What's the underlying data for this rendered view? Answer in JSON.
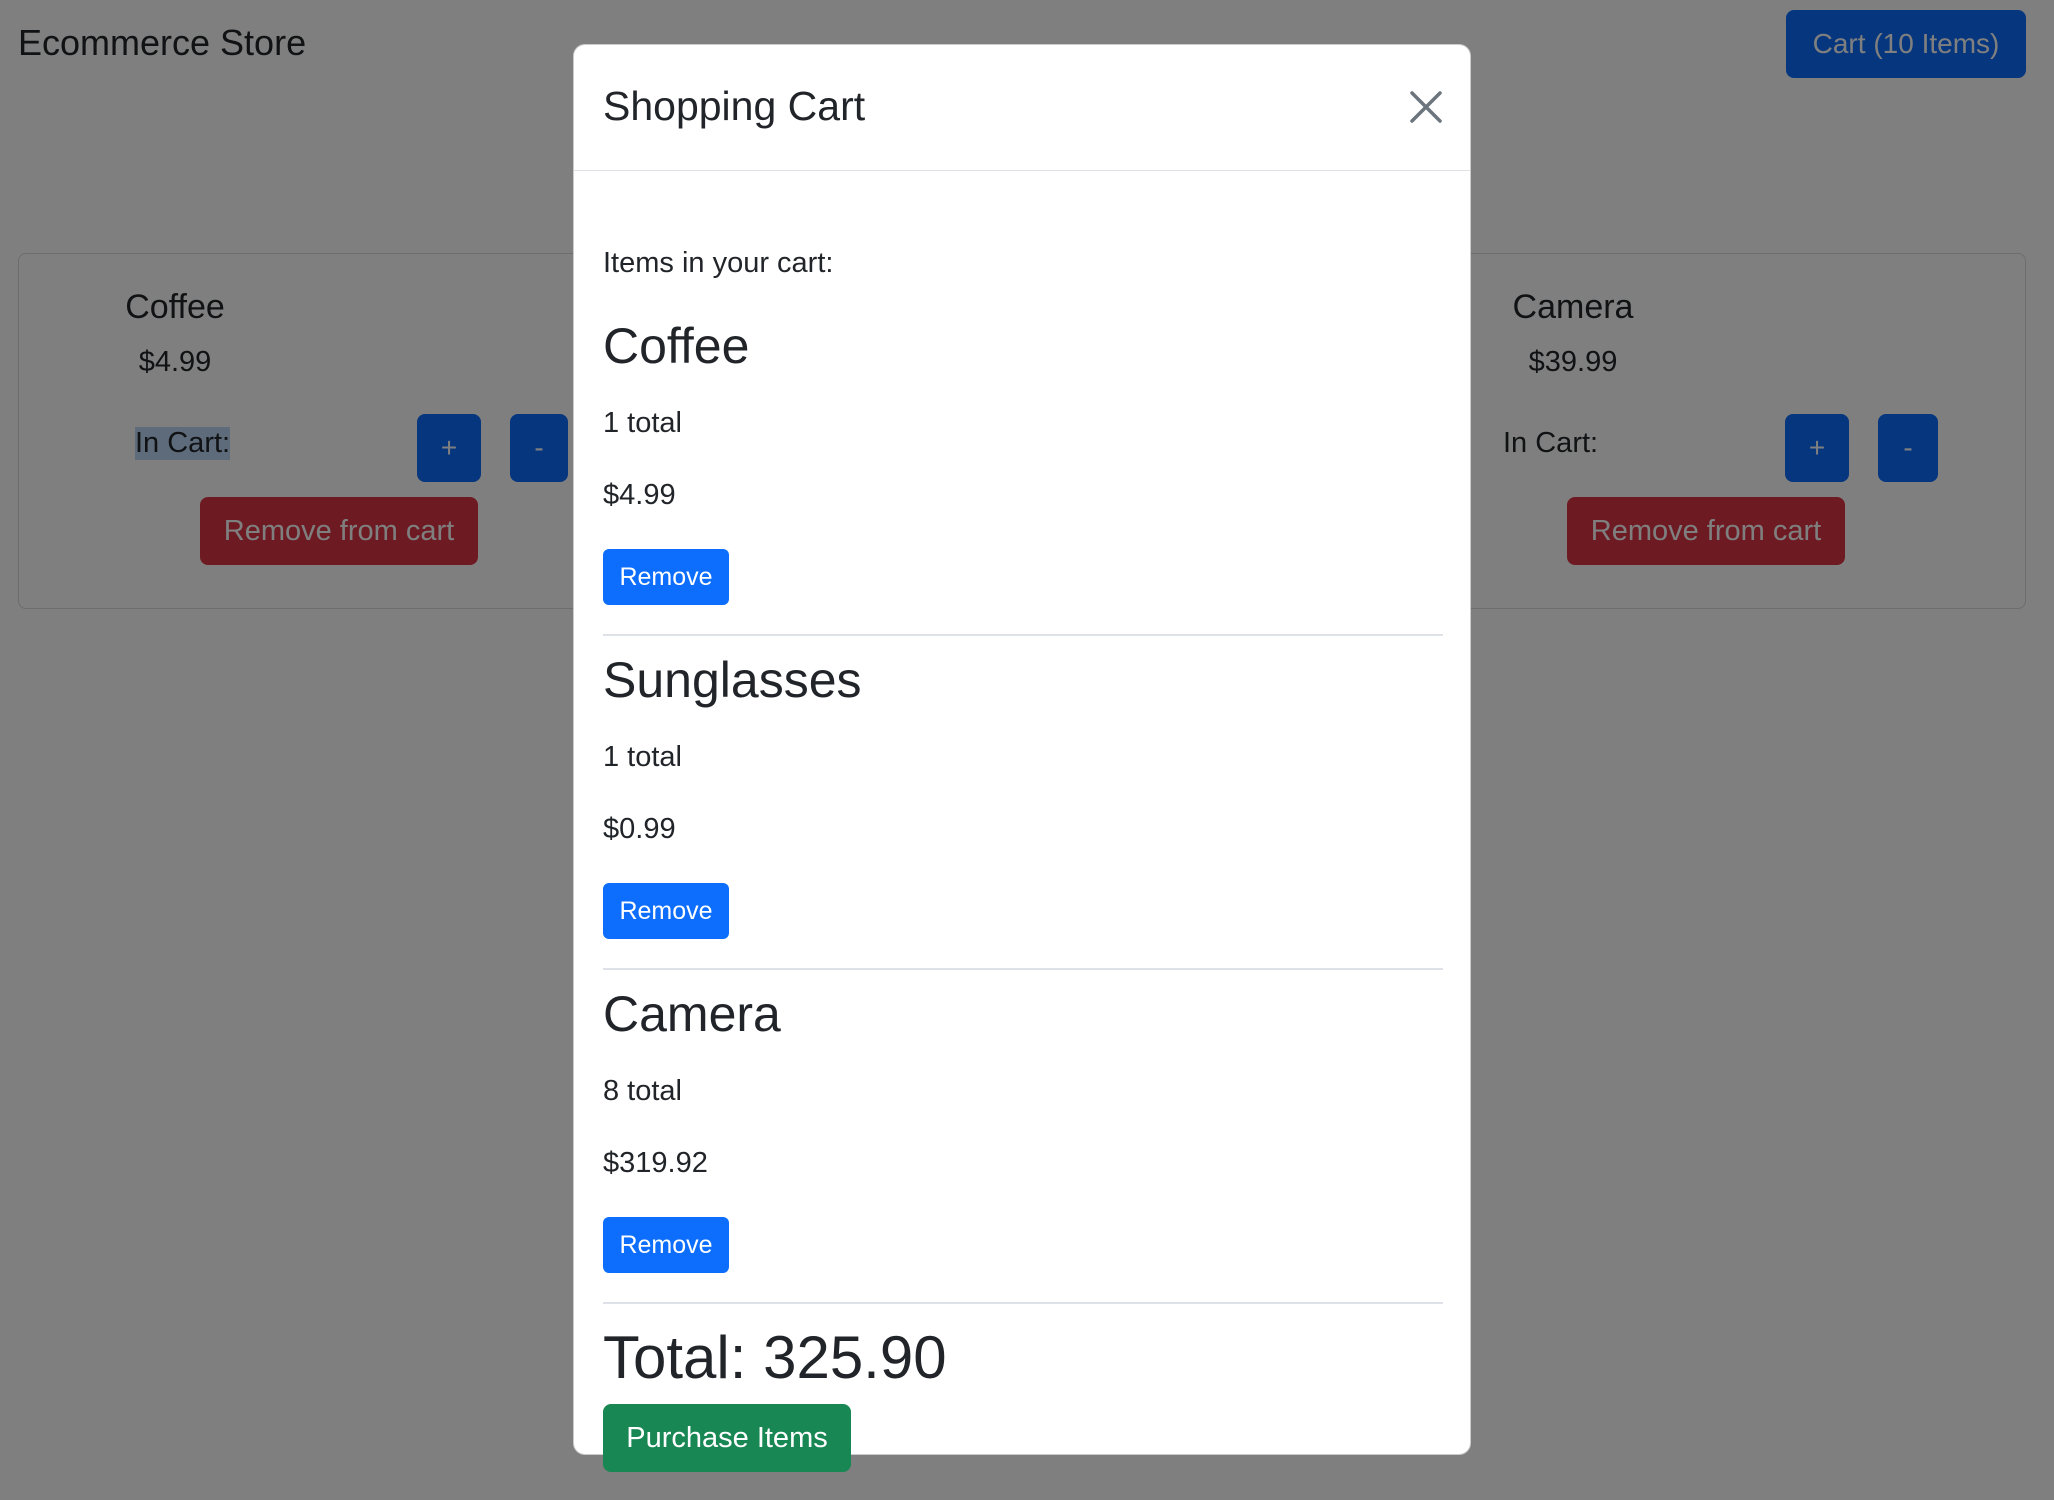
{
  "navbar": {
    "brand": "Ecommerce Store",
    "cart_button_label": "Cart (10 Items)"
  },
  "background_cards": [
    {
      "title": "Coffee",
      "price": "$4.99",
      "in_cart_label": "In Cart:",
      "plus_label": "+",
      "minus_label": "-",
      "remove_label": "Remove from cart"
    },
    {
      "title": "Camera",
      "price": "$39.99",
      "in_cart_label": "In Cart:",
      "plus_label": "+",
      "minus_label": "-",
      "remove_label": "Remove from cart"
    }
  ],
  "modal": {
    "title": "Shopping Cart",
    "intro": "Items in your cart:",
    "items": [
      {
        "name": "Coffee",
        "quantity": "1 total",
        "price": "$4.99",
        "remove_label": "Remove"
      },
      {
        "name": "Sunglasses",
        "quantity": "1 total",
        "price": "$0.99",
        "remove_label": "Remove"
      },
      {
        "name": "Camera",
        "quantity": "8 total",
        "price": "$319.92",
        "remove_label": "Remove"
      }
    ],
    "total": "Total: 325.90",
    "purchase_label": "Purchase Items"
  },
  "icons": {
    "close": "close-icon"
  },
  "colors": {
    "primary": "#0d6efd",
    "danger": "#dc3545",
    "success": "#198754",
    "backdrop": "rgba(0,0,0,0.5)"
  }
}
